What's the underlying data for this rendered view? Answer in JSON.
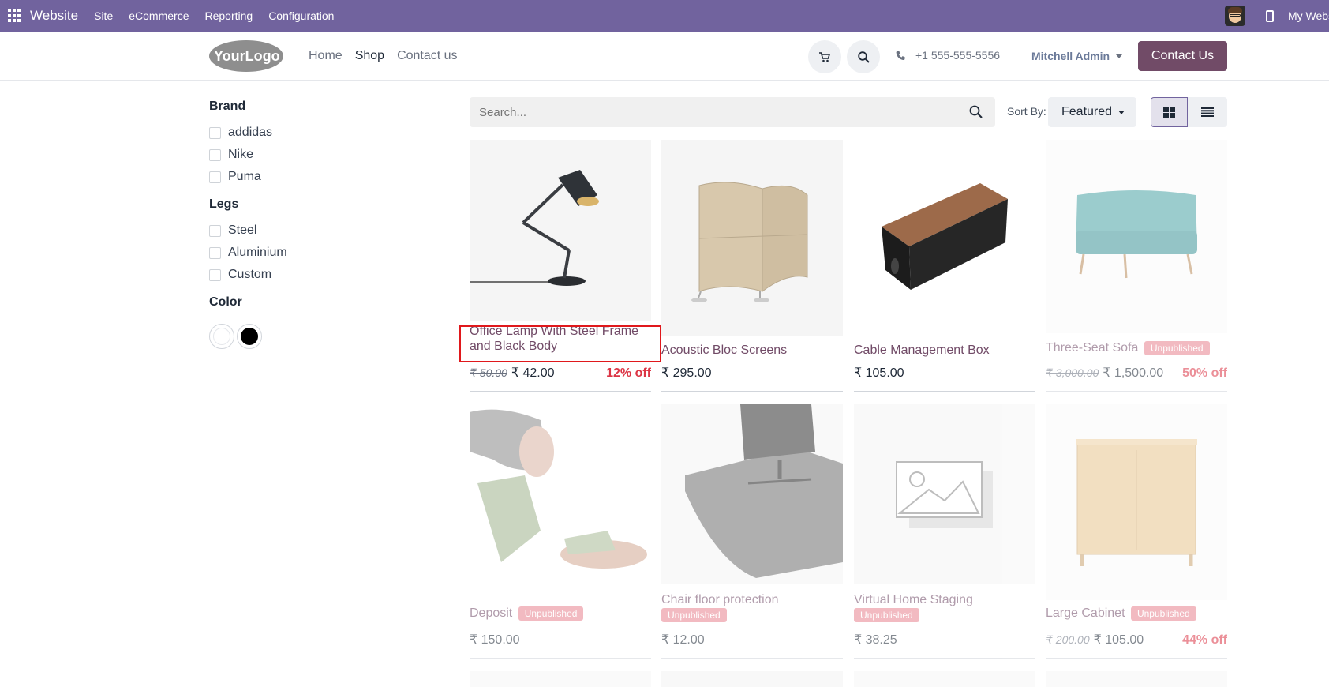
{
  "adminbar": {
    "app_name": "Website",
    "menus": [
      "Site",
      "eCommerce",
      "Reporting",
      "Configuration"
    ],
    "my_website": "My Website"
  },
  "header": {
    "nav": [
      "Home",
      "Shop",
      "Contact us"
    ],
    "active_nav": "Shop",
    "phone": "+1 555-555-5556",
    "user": "Mitchell Admin",
    "contact_button": "Contact Us",
    "logo_text": "YourLogo"
  },
  "sidebar": {
    "brand_title": "Brand",
    "brands": [
      "addidas",
      "Nike",
      "Puma"
    ],
    "legs_title": "Legs",
    "legs": [
      "Steel",
      "Aluminium",
      "Custom"
    ],
    "color_title": "Color",
    "colors": [
      "#ffffff",
      "#000000"
    ]
  },
  "toolbar": {
    "search_placeholder": "Search...",
    "sort_label": "Sort By:",
    "sort_value": "Featured"
  },
  "products": [
    {
      "name": "Office Lamp With Steel Frame and Black Body",
      "old_price": "₹ 50.00",
      "price": "₹ 42.00",
      "discount": "12% off",
      "badge": ""
    },
    {
      "name": "Acoustic Bloc Screens",
      "old_price": "",
      "price": "₹ 295.00",
      "discount": "",
      "badge": ""
    },
    {
      "name": "Cable Management Box",
      "old_price": "",
      "price": "₹ 105.00",
      "discount": "",
      "badge": ""
    },
    {
      "name": "Three-Seat Sofa",
      "old_price": "₹ 3,000.00",
      "price": "₹ 1,500.00",
      "discount": "50% off",
      "badge": "Unpublished"
    },
    {
      "name": "Deposit",
      "old_price": "",
      "price": "₹ 150.00",
      "discount": "",
      "badge": "Unpublished"
    },
    {
      "name": "Chair floor protection",
      "old_price": "",
      "price": "₹ 12.00",
      "discount": "",
      "badge": "Unpublished"
    },
    {
      "name": "Virtual Home Staging",
      "old_price": "",
      "price": "₹ 38.25",
      "discount": "",
      "badge": "Unpublished"
    },
    {
      "name": "Large Cabinet",
      "old_price": "₹ 200.00",
      "price": "₹ 105.00",
      "discount": "44% off",
      "badge": "Unpublished"
    }
  ],
  "colors": {
    "adminbar": "#71639e",
    "brand": "#714b67",
    "badge": "#e8838f",
    "discount": "#dc3545",
    "highlight": "#e0181c"
  }
}
